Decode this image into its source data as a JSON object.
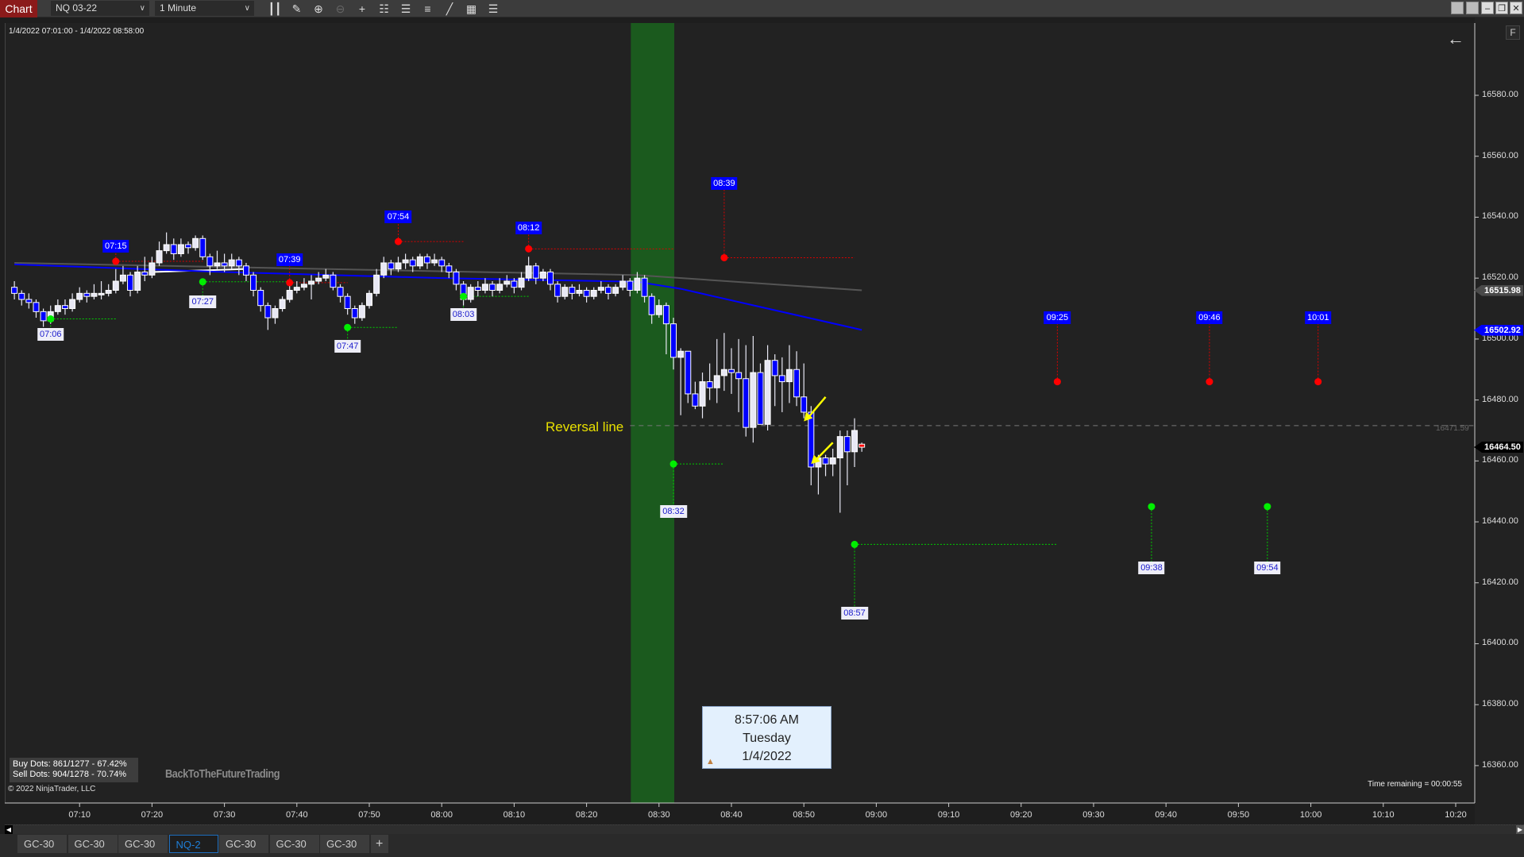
{
  "toolbar": {
    "chart_label": "Chart",
    "instrument": "NQ 03-22",
    "interval": "1 Minute",
    "icons": [
      "bar-type-icon",
      "draw-pencil-icon",
      "zoom-in-icon",
      "zoom-out-icon",
      "crosshair-icon",
      "data-box-icon",
      "chart-trader-icon",
      "strategy-icon",
      "indicator-icon",
      "properties-icon",
      "object-list-icon"
    ]
  },
  "header": {
    "date_range": "1/4/2022 07:01:00 - 1/4/2022 08:58:00",
    "f_button": "F"
  },
  "stats": {
    "buy": "Buy Dots: 861/1277 - 67.42%",
    "sell": "Sell Dots: 904/1278 - 70.74%"
  },
  "copyright": "© 2022 NinjaTrader, LLC",
  "watermark": "BackToTheFutureTrading",
  "time_remaining": "Time remaining = 00:00:55",
  "timebox": {
    "time": "8:57:06 AM",
    "day": "Tuesday",
    "date": "1/4/2022"
  },
  "reversal": {
    "label": "Reversal line",
    "price": 16471.59,
    "price_label": "16471.59",
    "color": "#e8e000"
  },
  "price_markers": [
    {
      "label": "16515.98",
      "price": 16515.98,
      "bg": "#4a4a4a",
      "fg": "#ffffff"
    },
    {
      "label": "16502.92",
      "price": 16502.92,
      "bg": "#0000ff",
      "fg": "#ffffff"
    },
    {
      "label": "16464.50",
      "price": 16464.5,
      "bg": "#000000",
      "fg": "#ffffff"
    }
  ],
  "tabs": [
    {
      "label": "GC-30"
    },
    {
      "label": "GC-30"
    },
    {
      "label": "GC-30"
    },
    {
      "label": "NQ-2",
      "active": true
    },
    {
      "label": "GC-30"
    },
    {
      "label": "GC-30"
    },
    {
      "label": "GC-30"
    }
  ],
  "add_tab": "+",
  "colors": {
    "up": "#e8e8f4",
    "down": "#0000ff",
    "sell_dot": "#ff0000",
    "buy_dot": "#00ee00",
    "highlight_band": "#1b5a1e",
    "ma_blue": "#0000ff",
    "ma_gray": "#555555"
  },
  "chart_data": {
    "type": "candlestick",
    "start_time": "07:01",
    "xlim": [
      "07:00",
      "10:25"
    ],
    "ylim": [
      16345,
      16602
    ],
    "yticks": [
      16360,
      16380,
      16400,
      16420,
      16440,
      16460,
      16480,
      16500,
      16520,
      16540,
      16560,
      16580
    ],
    "ytick_labels": [
      "16360.00",
      "16380.00",
      "16400.00",
      "16420.00",
      "16440.00",
      "16460.00",
      "16480.00",
      "16500.00",
      "16520.00",
      "16540.00",
      "16560.00",
      "16580.00"
    ],
    "xticks": [
      "07:10",
      "07:20",
      "07:30",
      "07:40",
      "07:50",
      "08:00",
      "08:10",
      "08:20",
      "08:30",
      "08:40",
      "08:50",
      "09:00",
      "09:10",
      "09:20",
      "09:30",
      "09:40",
      "09:50",
      "10:00",
      "10:10",
      "10:20"
    ],
    "highlight_band": [
      "08:26",
      "08:32"
    ],
    "ohlc": [
      [
        16517,
        16519,
        16513,
        16515
      ],
      [
        16515,
        16516,
        16511,
        16513
      ],
      [
        16513,
        16515,
        16510,
        16512
      ],
      [
        16512,
        16513,
        16507,
        16509
      ],
      [
        16509,
        16510,
        16504,
        16506
      ],
      [
        16506,
        16511,
        16505,
        16509
      ],
      [
        16509,
        16513,
        16508,
        16511
      ],
      [
        16511,
        16513,
        16508,
        16510
      ],
      [
        16510,
        16515,
        16509,
        16513
      ],
      [
        16513,
        16517,
        16512,
        16515
      ],
      [
        16515,
        16516,
        16512,
        16514
      ],
      [
        16514,
        16518,
        16513,
        16515
      ],
      [
        16515,
        16519,
        16513,
        16515
      ],
      [
        16515,
        16518,
        16514,
        16516
      ],
      [
        16516,
        16523,
        16515,
        16519
      ],
      [
        16519,
        16524,
        16518,
        16521
      ],
      [
        16521,
        16522,
        16514,
        16516
      ],
      [
        16516,
        16524,
        16515,
        16522
      ],
      [
        16522,
        16527,
        16519,
        16521
      ],
      [
        16521,
        16527,
        16520,
        16525
      ],
      [
        16525,
        16532,
        16524,
        16529
      ],
      [
        16529,
        16535,
        16528,
        16531
      ],
      [
        16531,
        16533,
        16526,
        16528
      ],
      [
        16528,
        16533,
        16527,
        16531
      ],
      [
        16531,
        16532,
        16528,
        16530
      ],
      [
        16530,
        16534,
        16529,
        16533
      ],
      [
        16533,
        16534,
        16526,
        16527
      ],
      [
        16527,
        16528,
        16521,
        16524
      ],
      [
        16524,
        16529,
        16523,
        16525
      ],
      [
        16525,
        16528,
        16522,
        16524
      ],
      [
        16524,
        16528,
        16523,
        16526
      ],
      [
        16526,
        16527,
        16521,
        16524
      ],
      [
        16524,
        16525,
        16519,
        16521
      ],
      [
        16521,
        16522,
        16514,
        16516
      ],
      [
        16516,
        16517,
        16509,
        16511
      ],
      [
        16511,
        16512,
        16503,
        16507
      ],
      [
        16507,
        16511,
        16505,
        16510
      ],
      [
        16510,
        16514,
        16509,
        16513
      ],
      [
        16513,
        16518,
        16512,
        16516
      ],
      [
        16516,
        16519,
        16515,
        16517
      ],
      [
        16517,
        16520,
        16516,
        16518
      ],
      [
        16518,
        16521,
        16513,
        16519
      ],
      [
        16519,
        16522,
        16518,
        16520
      ],
      [
        16520,
        16523,
        16519,
        16521
      ],
      [
        16521,
        16522,
        16516,
        16517
      ],
      [
        16517,
        16518,
        16512,
        16514
      ],
      [
        16514,
        16515,
        16508,
        16510
      ],
      [
        16510,
        16511,
        16505,
        16507
      ],
      [
        16507,
        16512,
        16506,
        16511
      ],
      [
        16511,
        16516,
        16510,
        16515
      ],
      [
        16515,
        16523,
        16514,
        16521
      ],
      [
        16521,
        16527,
        16520,
        16525
      ],
      [
        16525,
        16526,
        16521,
        16523
      ],
      [
        16523,
        16527,
        16522,
        16525
      ],
      [
        16525,
        16528,
        16523,
        16526
      ],
      [
        16526,
        16527,
        16522,
        16524
      ],
      [
        16524,
        16528,
        16523,
        16527
      ],
      [
        16527,
        16528,
        16523,
        16525
      ],
      [
        16525,
        16528,
        16524,
        16526
      ],
      [
        16526,
        16527,
        16522,
        16524
      ],
      [
        16524,
        16525,
        16520,
        16522
      ],
      [
        16522,
        16523,
        16516,
        16518
      ],
      [
        16518,
        16519,
        16511,
        16513
      ],
      [
        16513,
        16518,
        16512,
        16517
      ],
      [
        16517,
        16519,
        16514,
        16516
      ],
      [
        16516,
        16520,
        16515,
        16518
      ],
      [
        16518,
        16519,
        16514,
        16516
      ],
      [
        16516,
        16520,
        16515,
        16518
      ],
      [
        16518,
        16521,
        16517,
        16519
      ],
      [
        16519,
        16520,
        16515,
        16517
      ],
      [
        16517,
        16522,
        16516,
        16520
      ],
      [
        16520,
        16527,
        16519,
        16524
      ],
      [
        16524,
        16525,
        16518,
        16520
      ],
      [
        16520,
        16523,
        16519,
        16522
      ],
      [
        16522,
        16523,
        16516,
        16518
      ],
      [
        16518,
        16519,
        16512,
        16514
      ],
      [
        16514,
        16518,
        16513,
        16517
      ],
      [
        16517,
        16518,
        16513,
        16515
      ],
      [
        16515,
        16518,
        16514,
        16516
      ],
      [
        16516,
        16517,
        16512,
        16514
      ],
      [
        16514,
        16517,
        16513,
        16516
      ],
      [
        16516,
        16519,
        16515,
        16517
      ],
      [
        16517,
        16518,
        16513,
        16515
      ],
      [
        16515,
        16518,
        16514,
        16517
      ],
      [
        16517,
        16521,
        16516,
        16519
      ],
      [
        16519,
        16520,
        16514,
        16516
      ],
      [
        16516,
        16522,
        16515,
        16520
      ],
      [
        16520,
        16521,
        16512,
        16514
      ],
      [
        16514,
        16515,
        16505,
        16508
      ],
      [
        16508,
        16513,
        16507,
        16511
      ],
      [
        16511,
        16512,
        16495,
        16505
      ],
      [
        16505,
        16507,
        16490,
        16494
      ],
      [
        16494,
        16497,
        16475,
        16496
      ],
      [
        16496,
        16496,
        16479,
        16482
      ],
      [
        16482,
        16486,
        16477,
        16478
      ],
      [
        16478,
        16489,
        16474,
        16486
      ],
      [
        16486,
        16492,
        16480,
        16484
      ],
      [
        16484,
        16500,
        16479,
        16488
      ],
      [
        16488,
        16502,
        16483,
        16490
      ],
      [
        16490,
        16497,
        16482,
        16489
      ],
      [
        16489,
        16500,
        16476,
        16487
      ],
      [
        16487,
        16498,
        16468,
        16471
      ],
      [
        16471,
        16501,
        16466,
        16489
      ],
      [
        16489,
        16492,
        16474,
        16472
      ],
      [
        16472,
        16498,
        16470,
        16493
      ],
      [
        16493,
        16495,
        16478,
        16488
      ],
      [
        16488,
        16494,
        16476,
        16486
      ],
      [
        16486,
        16498,
        16479,
        16490
      ],
      [
        16490,
        16496,
        16478,
        16481
      ],
      [
        16481,
        16492,
        16474,
        16476
      ],
      [
        16476,
        16478,
        16452,
        16458
      ],
      [
        16458,
        16462,
        16449,
        16461
      ],
      [
        16461,
        16462,
        16455,
        16459
      ],
      [
        16459,
        16464,
        16455,
        16461
      ],
      [
        16461,
        16470,
        16443,
        16468
      ],
      [
        16468,
        16470,
        16452,
        16463
      ],
      [
        16463,
        16474,
        16458,
        16470
      ],
      [
        16465.5,
        16466,
        16463,
        16464.5
      ]
    ],
    "lines": [
      {
        "color": "#555555",
        "points": [
          [
            "07:01",
            16525
          ],
          [
            "08:27",
            16521
          ],
          [
            "08:58",
            16516
          ]
        ]
      },
      {
        "color": "#ffffff",
        "points": [
          [
            "07:20",
            16522
          ],
          [
            "07:33",
            16523
          ]
        ]
      },
      {
        "color": "#0000ff",
        "points": [
          [
            "07:01",
            16524.5
          ],
          [
            "07:30",
            16522
          ],
          [
            "08:00",
            16520
          ],
          [
            "08:27",
            16518.8
          ],
          [
            "08:33",
            16516.5
          ],
          [
            "08:45",
            16510
          ],
          [
            "08:58",
            16503
          ]
        ]
      }
    ],
    "signals": [
      {
        "type": "sell",
        "label": "07:15",
        "time": "07:15",
        "price": 16525.5,
        "label_price": 16530.5,
        "line_end": "07:27"
      },
      {
        "type": "sell",
        "label": "07:39",
        "time": "07:39",
        "price": 16518.5,
        "label_price": 16526,
        "line_end": "07:47"
      },
      {
        "type": "sell",
        "label": "07:54",
        "time": "07:54",
        "price": 16532,
        "label_price": 16540,
        "line_end": "08:03"
      },
      {
        "type": "sell",
        "label": "08:12",
        "time": "08:12",
        "price": 16529.6,
        "label_price": 16536.5,
        "line_end": "08:32"
      },
      {
        "type": "sell",
        "label": "08:39",
        "time": "08:39",
        "price": 16526.7,
        "label_price": 16551,
        "line_end": "08:57"
      },
      {
        "type": "sell",
        "label": "09:25",
        "time": "09:25",
        "price": 16486,
        "label_price": 16507
      },
      {
        "type": "sell",
        "label": "09:46",
        "time": "09:46",
        "price": 16486,
        "label_price": 16507
      },
      {
        "type": "sell",
        "label": "10:01",
        "time": "10:01",
        "price": 16486,
        "label_price": 16507
      },
      {
        "type": "buy",
        "label": "07:06",
        "time": "07:06",
        "price": 16506.6,
        "label_price": 16501.5,
        "line_end": "07:15"
      },
      {
        "type": "buy",
        "label": "07:27",
        "time": "07:27",
        "price": 16518.8,
        "label_price": 16512.3,
        "line_end": "07:39"
      },
      {
        "type": "buy",
        "label": "07:47",
        "time": "07:47",
        "price": 16503.8,
        "label_price": 16497.5,
        "line_end": "07:54"
      },
      {
        "type": "buy",
        "label": "08:03",
        "time": "08:03",
        "price": 16514,
        "label_price": 16508,
        "line_end": "08:12"
      },
      {
        "type": "buy",
        "label": "08:32",
        "time": "08:32",
        "price": 16459,
        "label_price": 16443.5,
        "line_end": "08:39"
      },
      {
        "type": "buy",
        "label": "08:57",
        "time": "08:57",
        "price": 16432.6,
        "label_price": 16410,
        "line_end": "09:25"
      },
      {
        "type": "buy",
        "label": "09:38",
        "time": "09:38",
        "price": 16445,
        "label_price": 16425
      },
      {
        "type": "buy",
        "label": "09:54",
        "time": "09:54",
        "price": 16445,
        "label_price": 16425
      }
    ],
    "arrows": [
      {
        "from": [
          "08:53",
          16481
        ],
        "to": [
          "08:50",
          16473
        ]
      },
      {
        "from": [
          "08:54",
          16466
        ],
        "to": [
          "08:51",
          16459
        ]
      }
    ]
  }
}
